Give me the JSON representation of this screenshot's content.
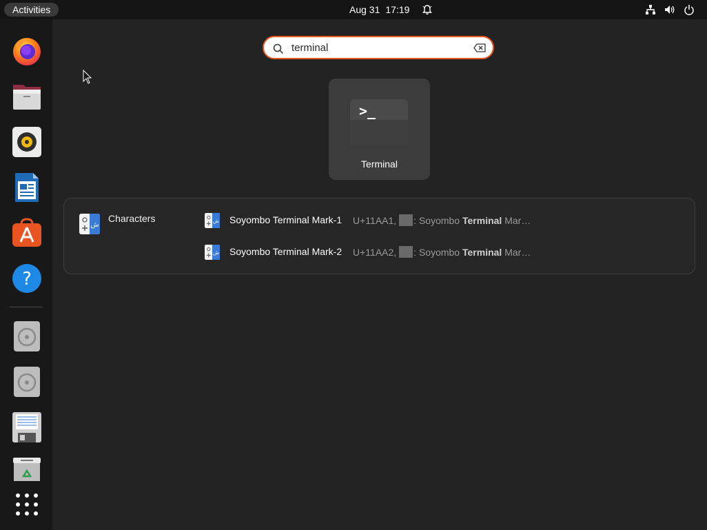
{
  "topbar": {
    "activities_label": "Activities",
    "date": "Aug 31",
    "time": "17:19"
  },
  "dock": {
    "items": [
      "firefox-icon",
      "files-icon",
      "rhythmbox-icon",
      "libreoffice-writer-icon",
      "app-center-icon",
      "help-icon",
      "disc-drive-icon",
      "disc-drive-icon",
      "floppy-drive-icon",
      "trash-icon",
      "show-apps-icon"
    ]
  },
  "search": {
    "value": "terminal"
  },
  "apps": [
    {
      "label": "Terminal",
      "icon": "terminal-icon"
    }
  ],
  "results": {
    "provider": "Characters",
    "items": [
      {
        "title": "Soyombo Terminal Mark-1",
        "code": "U+11AA1,",
        "desc_prefix": ": Soyombo ",
        "desc_bold": "Terminal",
        "desc_suffix": " Mar…"
      },
      {
        "title": "Soyombo Terminal Mark-2",
        "code": "U+11AA2,",
        "desc_prefix": ": Soyombo ",
        "desc_bold": "Terminal",
        "desc_suffix": " Mar…"
      }
    ]
  },
  "colors": {
    "accent": "#e95420",
    "background": "#232323",
    "panel": "#141414"
  }
}
